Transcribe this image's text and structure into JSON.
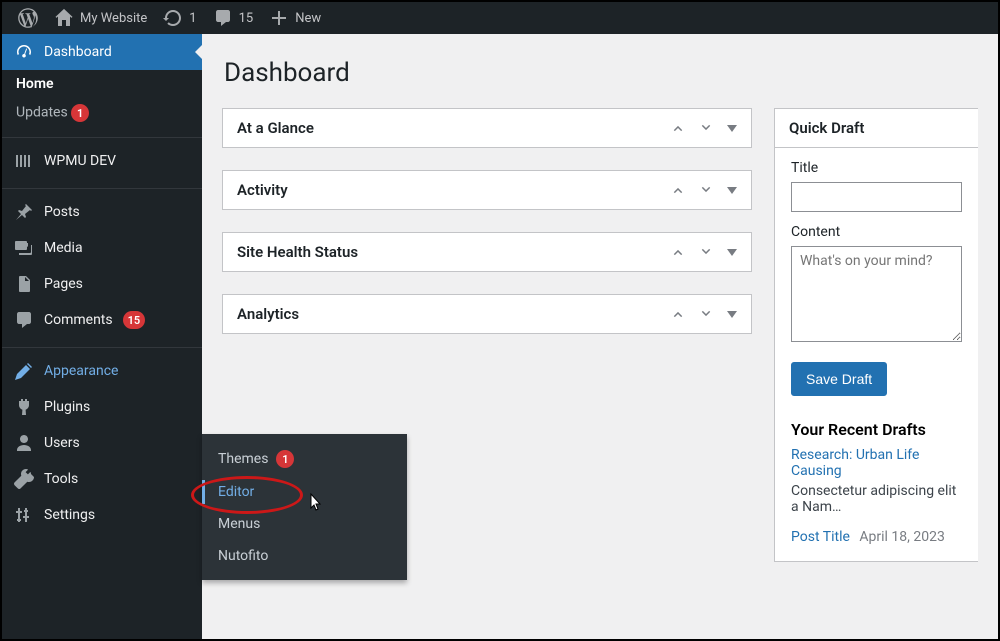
{
  "adminbar": {
    "site_name": "My Website",
    "updates_count": "1",
    "comments_count": "15",
    "new_label": "New"
  },
  "sidebar": {
    "dashboard": {
      "label": "Dashboard"
    },
    "dashboard_sub": {
      "home": "Home",
      "updates": "Updates",
      "updates_badge": "1"
    },
    "wpmudev": {
      "label": "WPMU DEV"
    },
    "posts": {
      "label": "Posts"
    },
    "media": {
      "label": "Media"
    },
    "pages": {
      "label": "Pages"
    },
    "comments": {
      "label": "Comments",
      "badge": "15"
    },
    "appearance": {
      "label": "Appearance"
    },
    "plugins": {
      "label": "Plugins"
    },
    "users": {
      "label": "Users"
    },
    "tools": {
      "label": "Tools"
    },
    "settings": {
      "label": "Settings"
    }
  },
  "appearance_submenu": {
    "themes": {
      "label": "Themes",
      "badge": "1"
    },
    "editor": "Editor",
    "menus": "Menus",
    "nutofito": "Nutofito"
  },
  "page": {
    "title": "Dashboard"
  },
  "boxes": {
    "at_a_glance": "At a Glance",
    "activity": "Activity",
    "site_health": "Site Health Status",
    "analytics": "Analytics"
  },
  "quick_draft": {
    "heading": "Quick Draft",
    "title_label": "Title",
    "title_value": "",
    "content_label": "Content",
    "content_placeholder": "What's on your mind?",
    "save_button": "Save Draft",
    "recent_drafts_heading": "Your Recent Drafts",
    "drafts": [
      {
        "title": "Research: Urban Life Causing",
        "excerpt": "Consectetur adipiscing elit a Nam…"
      },
      {
        "title": "Post Title",
        "date": "April 18, 2023"
      }
    ]
  }
}
